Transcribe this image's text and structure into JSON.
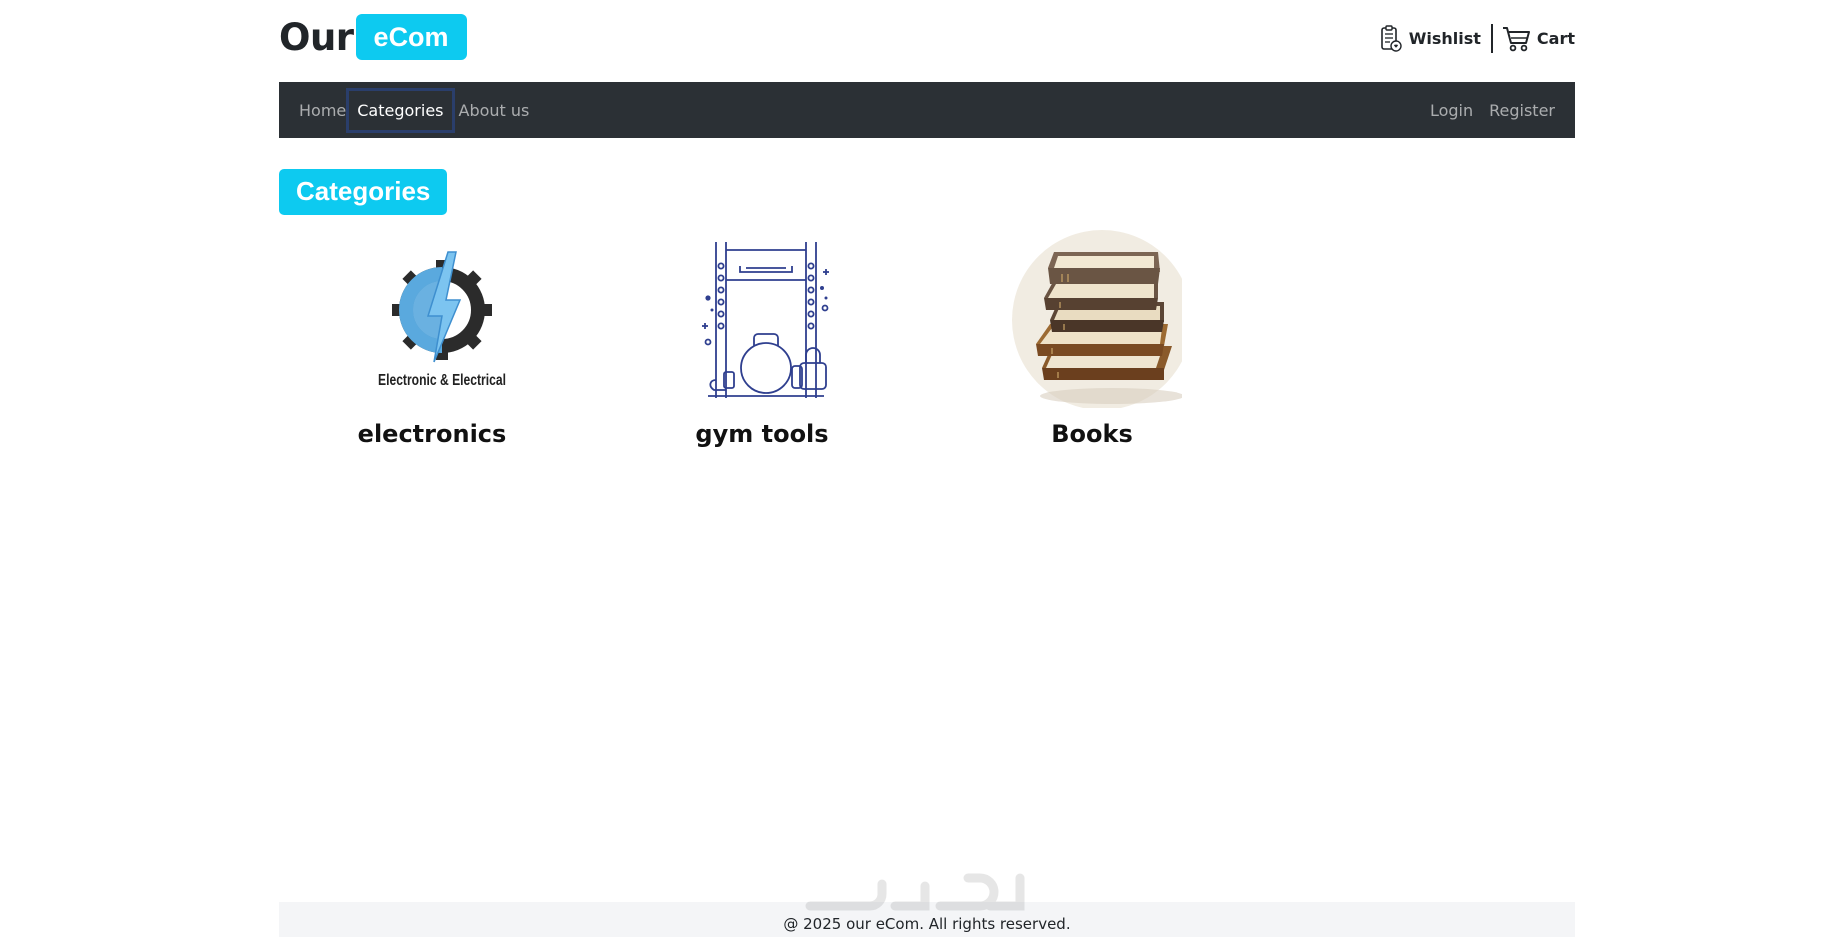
{
  "header": {
    "logo_prefix": "Our",
    "logo_badge": "eCom",
    "wishlist_label": "Wishlist",
    "cart_label": "Cart"
  },
  "nav": {
    "left": [
      {
        "label": "Home",
        "active": false
      },
      {
        "label": "Categories",
        "active": true
      },
      {
        "label": "About us",
        "active": false
      }
    ],
    "right": [
      {
        "label": "Login"
      },
      {
        "label": "Register"
      }
    ]
  },
  "main": {
    "title": "Categories",
    "categories": [
      {
        "name": "electronics",
        "logo_text": "Electronic & Electrical",
        "icon": "gear-lightning-icon"
      },
      {
        "name": "gym tools",
        "icon": "gym-rack-icon"
      },
      {
        "name": "Books",
        "icon": "book-stack-icon"
      }
    ]
  },
  "footer": {
    "text": "@ 2025 our eCom. All rights reserved."
  },
  "colors": {
    "accent": "#0dcaf0",
    "navbar_bg": "#2b3035",
    "active_border": "#2a3e6b",
    "footer_bg": "#f4f5f7"
  }
}
